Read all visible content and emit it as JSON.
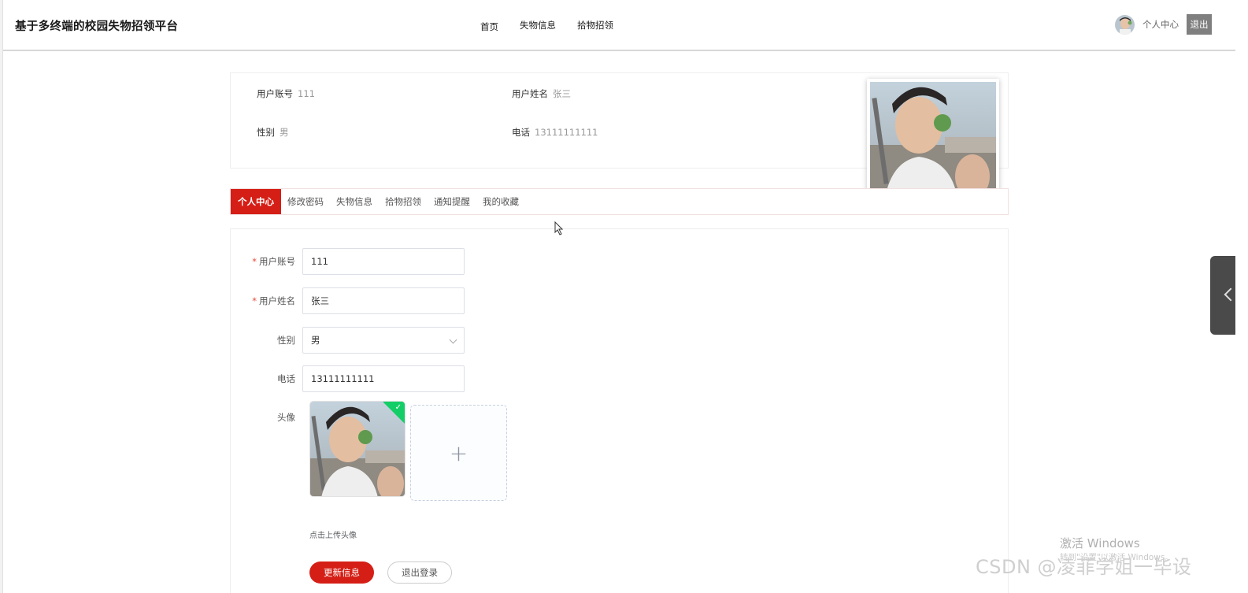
{
  "header": {
    "brand": "基于多终端的校园失物招领平台",
    "nav": [
      "首页",
      "失物信息",
      "拾物招领"
    ],
    "user_center": "个人中心",
    "logout": "退出"
  },
  "profile": {
    "fields": [
      {
        "label": "用户账号",
        "value": "111"
      },
      {
        "label": "用户姓名",
        "value": "张三"
      },
      {
        "label": "性别",
        "value": "男"
      },
      {
        "label": "电话",
        "value": "13111111111"
      }
    ]
  },
  "tabs": [
    "个人中心",
    "修改密码",
    "失物信息",
    "拾物招领",
    "通知提醒",
    "我的收藏"
  ],
  "form": {
    "account": {
      "label": "用户账号",
      "value": "111"
    },
    "name": {
      "label": "用户姓名",
      "value": "张三"
    },
    "gender": {
      "label": "性别",
      "value": "男"
    },
    "phone": {
      "label": "电话",
      "value": "13111111111"
    },
    "avatar": {
      "label": "头像",
      "tip": "点击上传头像"
    },
    "update_button": "更新信息",
    "logout_button": "退出登录"
  },
  "watermarks": {
    "windows": "激活 Windows",
    "windows_sub": "转到\"设置\"以激活 Windows。",
    "csdn": "CSDN @凌菲学姐一毕设"
  },
  "colors": {
    "accent": "#d51f16",
    "success": "#13ce66"
  },
  "icons": {
    "plus": "plus-icon",
    "check": "check-icon",
    "chevron": "chevron-down-icon"
  }
}
